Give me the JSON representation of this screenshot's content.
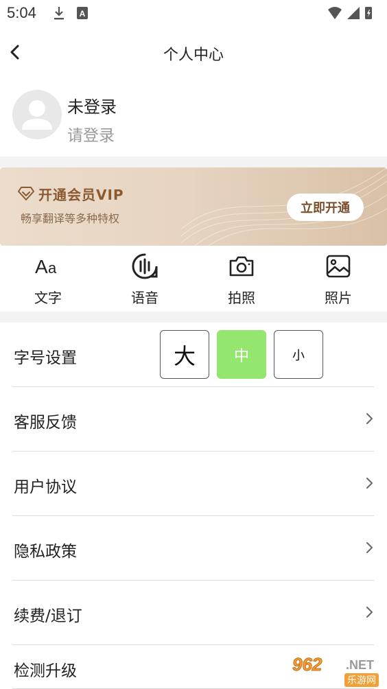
{
  "status_bar": {
    "time": "5:04",
    "icons": [
      "download-icon",
      "a-notification-icon",
      "wifi-icon",
      "signal-icon",
      "battery-icon"
    ]
  },
  "nav": {
    "back_icon": "chevron-left-icon",
    "title": "个人中心"
  },
  "profile": {
    "avatar_icon": "user-avatar-icon",
    "name": "未登录",
    "subtitle": "请登录"
  },
  "vip_banner": {
    "icon": "diamond-icon",
    "title": "开通会员VIP",
    "subtitle": "畅享翻译等多种特权",
    "button_label": "立即开通",
    "colors": {
      "bg_start": "#ecdccb",
      "bg_end": "#d9c1a7",
      "text": "#8a5a32"
    }
  },
  "tools": [
    {
      "label": "文字",
      "icon": "text-aa-icon"
    },
    {
      "label": "语音",
      "icon": "voice-icon"
    },
    {
      "label": "拍照",
      "icon": "camera-icon"
    },
    {
      "label": "照片",
      "icon": "photo-icon"
    }
  ],
  "settings": {
    "font_size": {
      "label": "字号设置",
      "options": [
        "大",
        "中",
        "小"
      ],
      "selected": "中",
      "accent_color": "#95e66f"
    },
    "rows": [
      {
        "label": "客服反馈",
        "icon": "chevron-right-icon"
      },
      {
        "label": "用户协议",
        "icon": "chevron-right-icon"
      },
      {
        "label": "隐私政策",
        "icon": "chevron-right-icon"
      },
      {
        "label": "续费/退订",
        "icon": "chevron-right-icon"
      },
      {
        "label": "检测升级"
      }
    ]
  },
  "watermark": {
    "number": "962",
    "suffix": ".NET",
    "cn_text": "乐游网"
  }
}
